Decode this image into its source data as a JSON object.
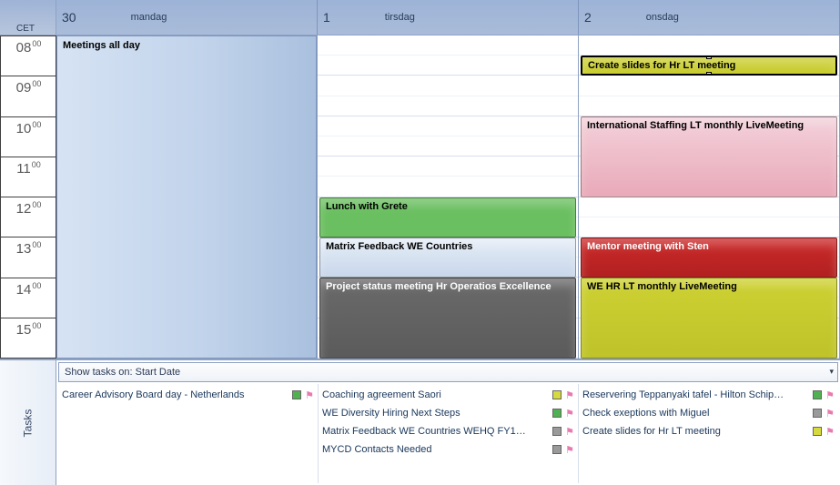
{
  "tz_label": "CET",
  "days": [
    {
      "num": "30",
      "name": "mandag"
    },
    {
      "num": "1",
      "name": "tirsdag"
    },
    {
      "num": "2",
      "name": "onsdag"
    }
  ],
  "hours": [
    "08",
    "09",
    "10",
    "11",
    "12",
    "13",
    "14",
    "15"
  ],
  "hour_min": "00",
  "events": {
    "mon_allday": "Meetings all day",
    "tue_lunch": "Lunch with Grete",
    "tue_matrix": "Matrix Feedback WE Countries",
    "tue_project": "Project status meeting Hr Operatios Excellence",
    "wed_slides": "Create slides for Hr LT meeting",
    "wed_intl": "International Staffing LT monthly LiveMeeting",
    "wed_mentor": "Mentor meeting with Sten",
    "wed_wehr": "WE HR LT monthly LiveMeeting"
  },
  "tasks_header": "Show tasks on: Start Date",
  "tasks_side": "Tasks",
  "tasks_col1": [
    {
      "label": "Career Advisory Board day - Netherlands",
      "cat": "green"
    }
  ],
  "tasks_col2": [
    {
      "label": "Coaching agreement Saori",
      "cat": "yellow"
    },
    {
      "label": "WE Diversity Hiring Next Steps",
      "cat": "green"
    },
    {
      "label": " Matrix  Feedback WE Countries  WEHQ FY1…",
      "cat": "grey"
    },
    {
      "label": "MYCD Contacts Needed",
      "cat": "grey"
    }
  ],
  "tasks_col3": [
    {
      "label": "Reservering Teppanyaki tafel - Hilton Schip…",
      "cat": "green"
    },
    {
      "label": "Check exeptions with Miguel",
      "cat": "grey"
    },
    {
      "label": "Create slides for Hr LT meeting",
      "cat": "yellow"
    }
  ]
}
